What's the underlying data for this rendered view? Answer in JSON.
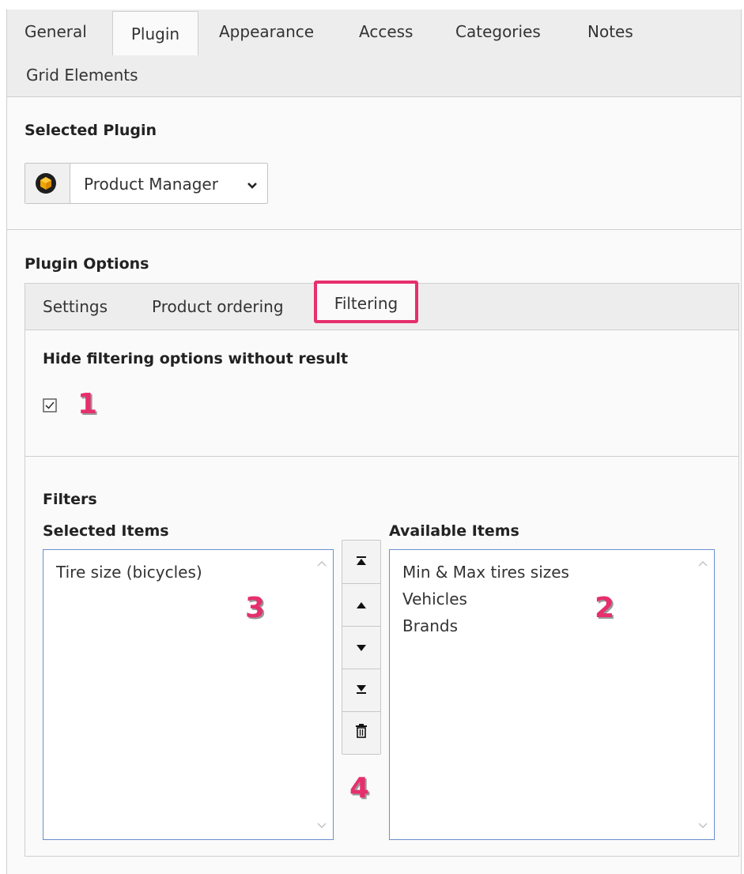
{
  "top_tabs": {
    "general": "General",
    "plugin": "Plugin",
    "appearance": "Appearance",
    "access": "Access",
    "categories": "Categories",
    "notes": "Notes",
    "grid_elements": "Grid Elements",
    "active": "Plugin"
  },
  "selected_plugin": {
    "heading": "Selected Plugin",
    "value": "Product Manager",
    "icon": "box-icon"
  },
  "plugin_options": {
    "heading": "Plugin Options",
    "tabs": {
      "settings": "Settings",
      "product_ordering": "Product ordering",
      "filtering": "Filtering"
    },
    "active_tab": "Filtering",
    "highlight_color": "#e62f6d"
  },
  "filtering": {
    "hide_heading": "Hide filtering options without result",
    "hide_checked": true,
    "filters_heading": "Filters",
    "selected_heading": "Selected Items",
    "available_heading": "Available Items",
    "selected_items": [
      "Tire size (bicycles)"
    ],
    "available_items": [
      "Min & Max tires sizes",
      "Vehicles",
      "Brands"
    ],
    "buttons": [
      "move-to-top-icon",
      "move-up-icon",
      "move-down-icon",
      "move-to-bottom-icon",
      "trash-icon"
    ]
  },
  "annotations": {
    "one": "1",
    "two": "2",
    "three": "3",
    "four": "4"
  }
}
